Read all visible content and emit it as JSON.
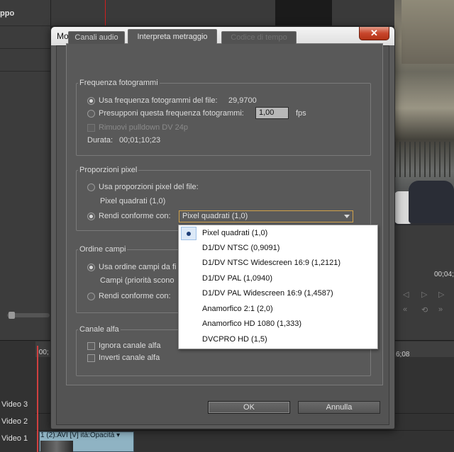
{
  "background": {
    "panel_label": "ppo",
    "time_right": "00;04;",
    "time_ruler_left": ";00;",
    "time_ruler_right": "6;08",
    "tracks": [
      "Video 3",
      "Video 2",
      "Video 1"
    ],
    "clip_label": "1 (2).AVI [V]  ità:Opacità ▾"
  },
  "dialog": {
    "title": "Modifica clip",
    "close_glyph": "✕",
    "tabs": [
      {
        "label": "Canali audio",
        "state": "normal"
      },
      {
        "label": "Interpreta metraggio",
        "state": "active"
      },
      {
        "label": "Codice di tempo",
        "state": "disabled"
      }
    ],
    "frame_rate": {
      "title": "Frequenza fotogrammi",
      "use_file_label": "Usa frequenza fotogrammi del file:",
      "use_file_value": "29,9700",
      "assume_label": "Presupponi questa frequenza fotogrammi:",
      "assume_value": "1,00",
      "assume_unit": "fps",
      "pulldown_label": "Rimuovi pulldown DV 24p",
      "duration_label": "Durata:",
      "duration_value": "00;01;10;23"
    },
    "pixel_aspect": {
      "title": "Proporzioni pixel",
      "use_file_label": "Usa proporzioni pixel del file:",
      "file_value": "Pixel quadrati (1,0)",
      "conform_label": "Rendi conforme con:",
      "conform_value": "Pixel quadrati (1,0)"
    },
    "field_order": {
      "title": "Ordine campi",
      "use_file_label": "Usa ordine campi da fi",
      "file_value": "Campi (priorità scono",
      "conform_label": "Rendi conforme con:"
    },
    "alpha": {
      "title": "Canale alfa",
      "ignore_label": "Ignora canale alfa",
      "invert_label": "Inverti canale alfa"
    },
    "ok_label": "OK",
    "cancel_label": "Annulla"
  },
  "dropdown": {
    "selected_index": 0,
    "options": [
      "Pixel quadrati (1,0)",
      "D1/DV NTSC (0,9091)",
      "D1/DV NTSC Widescreen 16:9 (1,2121)",
      "D1/DV PAL (1,0940)",
      "D1/DV PAL Widescreen 16:9 (1,4587)",
      "Anamorfico 2:1 (2,0)",
      "Anamorfico HD 1080 (1,333)",
      "DVCPRO HD (1,5)"
    ]
  }
}
